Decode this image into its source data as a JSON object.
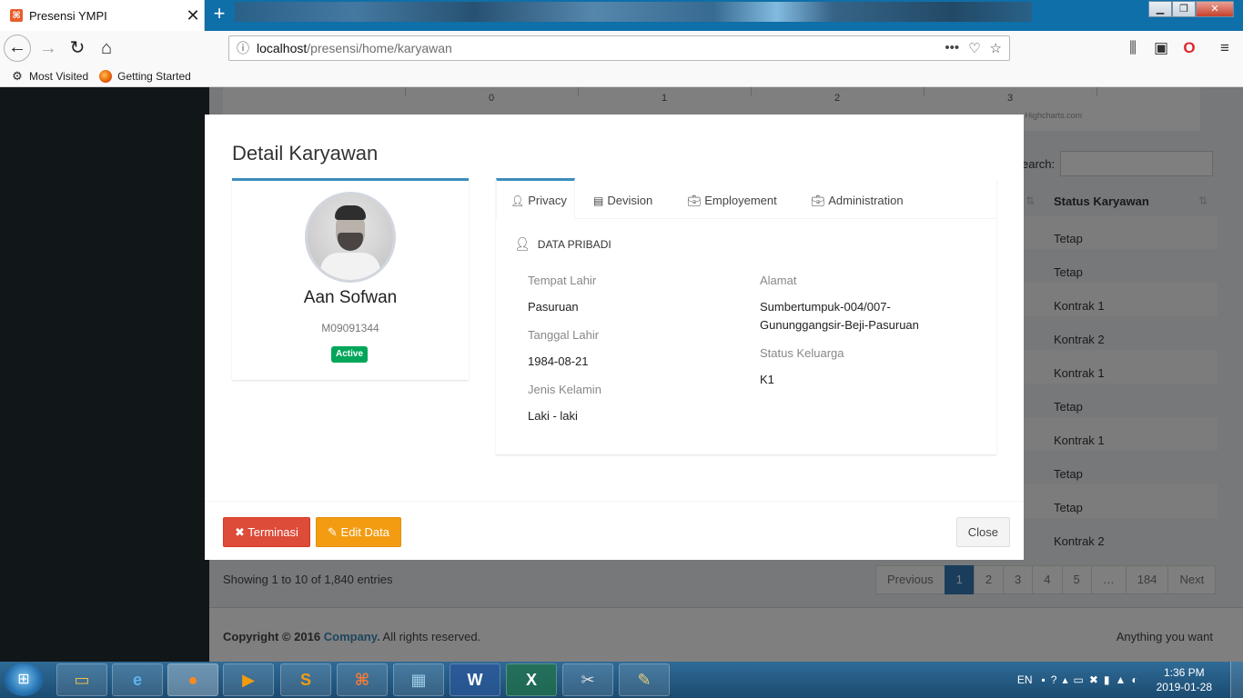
{
  "browser": {
    "tab_title": "Presensi YMPI",
    "tab_close": "✕",
    "new_tab": "+",
    "url_host": "localhost",
    "url_path": "/presensi/home/karyawan",
    "bookmarks": [
      {
        "label": "Most Visited"
      },
      {
        "label": "Getting Started"
      }
    ]
  },
  "page": {
    "chart_ticks": [
      "0",
      "1",
      "2",
      "3"
    ],
    "chart_credit": "Highcharts.com",
    "search_label": "earch:",
    "status_header": "Status Karyawan",
    "status_rows": [
      "Tetap",
      "Tetap",
      "Kontrak 1",
      "Kontrak 2",
      "Kontrak 1",
      "Tetap",
      "Kontrak 1",
      "Tetap",
      "Tetap",
      "Kontrak 2"
    ],
    "showing": "Showing 1 to 10 of 1,840 entries",
    "pagination": [
      "Previous",
      "1",
      "2",
      "3",
      "4",
      "5",
      "…",
      "184",
      "Next"
    ],
    "copyright_prefix": "Copyright © 2016",
    "company": "Company.",
    "copyright_suffix": " All rights reserved.",
    "footer_right": "Anything you want"
  },
  "modal": {
    "title": "Detail Karyawan",
    "profile": {
      "name": "Aan Sofwan",
      "employee_id": "M09091344",
      "status_badge": "Active"
    },
    "tabs": [
      {
        "label": "Privacy",
        "icon": "user-icon"
      },
      {
        "label": "Devision",
        "icon": "building-icon"
      },
      {
        "label": "Employement",
        "icon": "briefcase-icon"
      },
      {
        "label": "Administration",
        "icon": "briefcase-icon"
      }
    ],
    "section_title": "DATA PRIBADI",
    "fields": {
      "tempat_lahir_label": "Tempat Lahir",
      "tempat_lahir": "Pasuruan",
      "tanggal_lahir_label": "Tanggal Lahir",
      "tanggal_lahir": "1984-08-21",
      "jenis_kelamin_label": "Jenis Kelamin",
      "jenis_kelamin": "Laki - laki",
      "alamat_label": "Alamat",
      "alamat_line1": "Sumbertumpuk-004/007-",
      "alamat_line2": "Gununggangsir-Beji-Pasuruan",
      "status_keluarga_label": "Status Keluarga",
      "status_keluarga": "K1"
    },
    "buttons": {
      "terminasi": "Terminasi",
      "edit": "Edit Data",
      "close": "Close"
    }
  },
  "taskbar": {
    "lang": "EN",
    "time": "1:36 PM",
    "date": "2019-01-28"
  },
  "colors": {
    "primary": "#3c8dbc",
    "success": "#00a65a",
    "danger": "#dd4b39",
    "warning": "#f39c12"
  }
}
